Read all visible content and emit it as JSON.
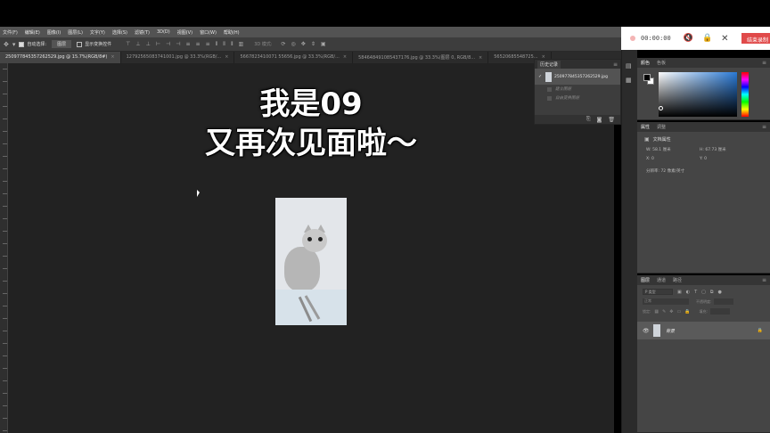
{
  "menu": [
    "文件(F)",
    "编辑(E)",
    "图像(I)",
    "图层(L)",
    "文字(Y)",
    "选择(S)",
    "滤镜(T)",
    "3D(D)",
    "视图(V)",
    "窗口(W)",
    "帮助(H)"
  ],
  "options": {
    "auto_select_label": "自动选择:",
    "auto_select_value": "图层",
    "show_transform_label": "显示变换控件",
    "mode_3d_label": "3D 模式:"
  },
  "tabs": [
    {
      "label": "2509778453572625​29.jpg @ 15.7%(RGB/8#)",
      "active": true
    },
    {
      "label": "12792565083741001.jpg @ 33.3%(RGB/...",
      "active": false
    },
    {
      "label": "5667823410071 55656.jpg @ 33.3%(RGB/...",
      "active": false
    },
    {
      "label": "584648491085437176.jpg @ 33.3%(图层 0, RGB/8...",
      "active": false
    },
    {
      "label": "56520685548725...",
      "active": false
    }
  ],
  "recorder": {
    "time": "00:00:00",
    "end_label": "结束录制"
  },
  "overlay": {
    "line1": "我是09",
    "line2": "又再次见面啦～"
  },
  "history": {
    "tab": "历史记录",
    "snapshot": "2509778453572625​29.jpg",
    "steps": [
      "建立图层",
      "自由变换图层"
    ]
  },
  "color_panel": {
    "tabs": [
      "颜色",
      "色板"
    ],
    "fg": "#000000",
    "bg": "#ffffff"
  },
  "properties": {
    "tabs": [
      "属性",
      "调整"
    ],
    "title": "文档属性",
    "w_label": "W: 58.1 厘米",
    "h_label": "H: 67.73 厘米",
    "x_label": "X: 0",
    "y_label": "Y: 0",
    "resolution": "分辨率: 72 像素/英寸"
  },
  "layers": {
    "tabs": [
      "图层",
      "通道",
      "路径"
    ],
    "filter_label": "P 类型",
    "mode_label": "正常",
    "opacity_label": "不透明度:",
    "lock_label": "锁定:",
    "fill_label": "填充:",
    "items": [
      {
        "name": "背景",
        "visible": true,
        "locked": true
      }
    ]
  }
}
